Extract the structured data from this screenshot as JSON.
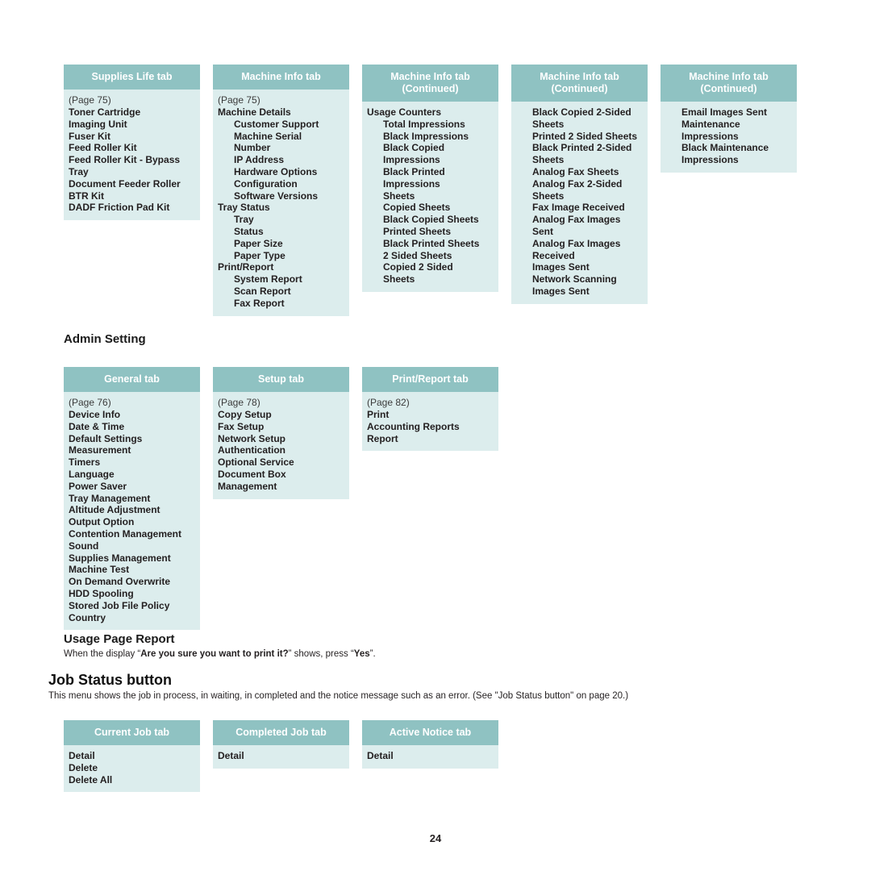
{
  "page": {
    "folio": "24"
  },
  "colors": {
    "tab_header_bg": "#8fc2c2",
    "tab_body_bg": "#dceded",
    "tab_header_text": "#ffffff",
    "body_text": "#231f20"
  },
  "machine_status_cards": [
    {
      "title": "Supplies Life tab",
      "subtitle": "",
      "pageref": "(Page 75)",
      "items": [
        {
          "label": "Toner Cartridge",
          "level": 1
        },
        {
          "label": "Imaging Unit",
          "level": 1
        },
        {
          "label": "Fuser Kit",
          "level": 1
        },
        {
          "label": "Feed Roller Kit",
          "level": 1
        },
        {
          "label": "Feed Roller Kit - Bypass",
          "level": 1
        },
        {
          "label": "Tray",
          "level": 1
        },
        {
          "label": "Document Feeder Roller",
          "level": 1
        },
        {
          "label": "BTR Kit",
          "level": 1
        },
        {
          "label": "DADF Friction Pad Kit",
          "level": 1
        }
      ]
    },
    {
      "title": "Machine Info tab",
      "subtitle": "",
      "pageref": "(Page 75)",
      "items": [
        {
          "label": "Machine Details",
          "level": 1
        },
        {
          "label": "Customer Support",
          "level": 2
        },
        {
          "label": "Machine Serial",
          "level": 2
        },
        {
          "label": "Number",
          "level": 2
        },
        {
          "label": "IP Address",
          "level": 2
        },
        {
          "label": "Hardware Options",
          "level": 2
        },
        {
          "label": "Configuration",
          "level": 2
        },
        {
          "label": "Software Versions",
          "level": 2
        },
        {
          "label": "Tray Status",
          "level": 1
        },
        {
          "label": "Tray",
          "level": 2
        },
        {
          "label": "Status",
          "level": 2
        },
        {
          "label": "Paper Size",
          "level": 2
        },
        {
          "label": "Paper Type",
          "level": 2
        },
        {
          "label": "Print/Report",
          "level": 1
        },
        {
          "label": "System Report",
          "level": 2
        },
        {
          "label": "Scan Report",
          "level": 2
        },
        {
          "label": "Fax Report",
          "level": 2
        }
      ]
    },
    {
      "title": "Machine Info tab",
      "subtitle": "(Continued)",
      "pageref": "",
      "items": [
        {
          "label": "Usage Counters",
          "level": 1
        },
        {
          "label": "Total Impressions",
          "level": 2
        },
        {
          "label": "Black Impressions",
          "level": 2
        },
        {
          "label": "Black Copied",
          "level": 2
        },
        {
          "label": "Impressions",
          "level": 2
        },
        {
          "label": "Black Printed",
          "level": 2
        },
        {
          "label": "Impressions",
          "level": 2
        },
        {
          "label": "Sheets",
          "level": 2
        },
        {
          "label": "Copied Sheets",
          "level": 2
        },
        {
          "label": "Black Copied Sheets",
          "level": 2
        },
        {
          "label": "Printed Sheets",
          "level": 2
        },
        {
          "label": "Black Printed Sheets",
          "level": 2
        },
        {
          "label": "2 Sided Sheets",
          "level": 2
        },
        {
          "label": "Copied 2 Sided",
          "level": 2
        },
        {
          "label": "Sheets",
          "level": 2
        }
      ]
    },
    {
      "title": "Machine Info tab",
      "subtitle": "(Continued)",
      "pageref": "",
      "items": [
        {
          "label": "Black Copied 2-Sided",
          "level": 2
        },
        {
          "label": "Sheets",
          "level": 2
        },
        {
          "label": "Printed 2 Sided Sheets",
          "level": 2
        },
        {
          "label": "Black Printed 2-Sided",
          "level": 2
        },
        {
          "label": "Sheets",
          "level": 2
        },
        {
          "label": "Analog Fax Sheets",
          "level": 2
        },
        {
          "label": "Analog Fax 2-Sided",
          "level": 2
        },
        {
          "label": "Sheets",
          "level": 2
        },
        {
          "label": "Fax Image Received",
          "level": 2
        },
        {
          "label": "Analog Fax Images",
          "level": 2
        },
        {
          "label": "Sent",
          "level": 2
        },
        {
          "label": "Analog Fax Images",
          "level": 2
        },
        {
          "label": "Received",
          "level": 2
        },
        {
          "label": "Images Sent",
          "level": 2
        },
        {
          "label": "Network Scanning",
          "level": 2
        },
        {
          "label": "Images Sent",
          "level": 2
        }
      ]
    },
    {
      "title": "Machine Info tab",
      "subtitle": "(Continued)",
      "pageref": "",
      "items": [
        {
          "label": "Email Images Sent",
          "level": 2
        },
        {
          "label": "Maintenance",
          "level": 2
        },
        {
          "label": "Impressions",
          "level": 2
        },
        {
          "label": "Black Maintenance",
          "level": 2
        },
        {
          "label": "Impressions",
          "level": 2
        }
      ]
    }
  ],
  "admin_setting": {
    "heading": "Admin Setting",
    "cards": [
      {
        "title": "General tab",
        "subtitle": "",
        "pageref": "(Page 76)",
        "items": [
          {
            "label": "Device Info",
            "level": 1
          },
          {
            "label": "Date & Time",
            "level": 1
          },
          {
            "label": "Default Settings",
            "level": 1
          },
          {
            "label": "Measurement",
            "level": 1
          },
          {
            "label": "Timers",
            "level": 1
          },
          {
            "label": "Language",
            "level": 1
          },
          {
            "label": "Power Saver",
            "level": 1
          },
          {
            "label": "Tray Management",
            "level": 1
          },
          {
            "label": "Altitude Adjustment",
            "level": 1
          },
          {
            "label": "Output Option",
            "level": 1
          },
          {
            "label": "Contention Management",
            "level": 1
          },
          {
            "label": "Sound",
            "level": 1
          },
          {
            "label": "Supplies Management",
            "level": 1
          },
          {
            "label": "Machine Test",
            "level": 1
          },
          {
            "label": "On Demand Overwrite",
            "level": 1
          },
          {
            "label": "HDD Spooling",
            "level": 1
          },
          {
            "label": "Stored Job File Policy",
            "level": 1
          },
          {
            "label": "Country",
            "level": 1
          }
        ]
      },
      {
        "title": "Setup tab",
        "subtitle": "",
        "pageref": "(Page 78)",
        "items": [
          {
            "label": "Copy Setup",
            "level": 1
          },
          {
            "label": "Fax Setup",
            "level": 1
          },
          {
            "label": "Network Setup",
            "level": 1
          },
          {
            "label": "Authentication",
            "level": 1
          },
          {
            "label": "Optional Service",
            "level": 1
          },
          {
            "label": "Document Box",
            "level": 1
          },
          {
            "label": "Management",
            "level": 1
          }
        ]
      },
      {
        "title": "Print/Report tab",
        "subtitle": "",
        "pageref": "(Page 82)",
        "items": [
          {
            "label": "Print",
            "level": 1
          },
          {
            "label": "Accounting Reports",
            "level": 1
          },
          {
            "label": "Report",
            "level": 1
          }
        ]
      }
    ]
  },
  "usage_page_report": {
    "heading": "Usage Page Report",
    "line_prefix": "When the display “",
    "line_bold1": "Are you sure you want to print it?",
    "line_middle": "” shows, press “",
    "line_bold2": "Yes",
    "line_suffix": "”."
  },
  "job_status": {
    "heading": "Job Status button",
    "description": "This menu shows the job in process, in waiting, in completed and the notice message such as an error. (See \"Job Status button\" on page 20.)",
    "cards": [
      {
        "title": "Current Job tab",
        "subtitle": "",
        "pageref": "",
        "items": [
          {
            "label": "Detail",
            "level": 1
          },
          {
            "label": "Delete",
            "level": 1
          },
          {
            "label": "Delete All",
            "level": 1
          }
        ]
      },
      {
        "title": "Completed Job tab",
        "subtitle": "",
        "pageref": "",
        "items": [
          {
            "label": "Detail",
            "level": 1
          }
        ]
      },
      {
        "title": "Active Notice tab",
        "subtitle": "",
        "pageref": "",
        "items": [
          {
            "label": "Detail",
            "level": 1
          }
        ]
      }
    ]
  }
}
